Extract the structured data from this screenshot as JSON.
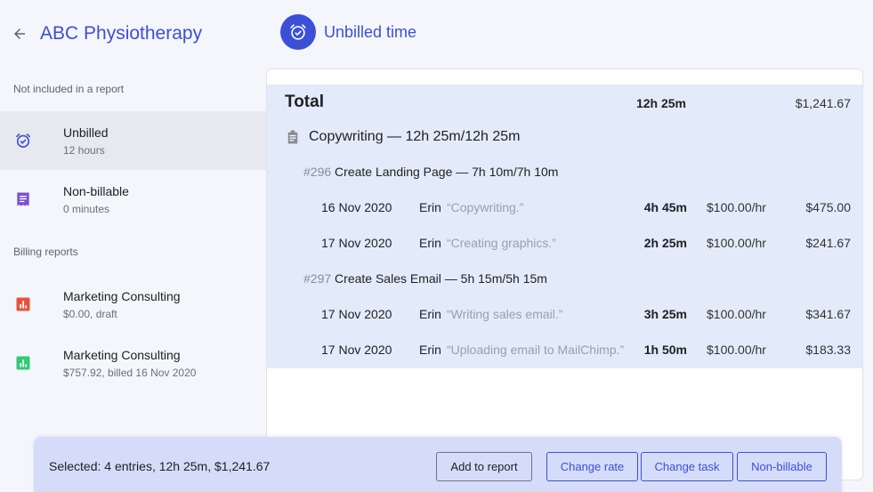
{
  "header": {
    "client_title": "ABC Physiotherapy",
    "page_title": "Unbilled time",
    "accent_color": "#3b4fd8"
  },
  "sidebar": {
    "section_not_included": "Not included in a report",
    "unbilled": {
      "name": "Unbilled",
      "sub": "12 hours",
      "icon": "alarm-clock-icon"
    },
    "nonbillable": {
      "name": "Non-billable",
      "sub": "0 minutes",
      "icon": "receipt-icon"
    },
    "section_reports": "Billing reports",
    "reports": [
      {
        "name": "Marketing Consulting",
        "sub": "$0.00, draft",
        "icon": "bar-chart-icon",
        "color": "#e5533d"
      },
      {
        "name": "Marketing Consulting",
        "sub": "$757.92, billed 16 Nov 2020",
        "icon": "bar-chart-icon",
        "color": "#2ecc71"
      }
    ]
  },
  "main": {
    "total_label": "Total",
    "total_time": "12h 25m",
    "total_amount": "$1,241.67",
    "group_label": "Copywriting — 12h 25m/12h 25m",
    "tasks": [
      {
        "num": "#296",
        "label": "Create Landing Page — 7h 10m/7h 10m",
        "entries": [
          {
            "date": "16 Nov 2020",
            "user": "Erin",
            "desc": "“Copywriting.”",
            "duration": "4h 45m",
            "rate": "$100.00/hr",
            "amount": "$475.00"
          },
          {
            "date": "17 Nov 2020",
            "user": "Erin",
            "desc": "“Creating graphics.”",
            "duration": "2h 25m",
            "rate": "$100.00/hr",
            "amount": "$241.67"
          }
        ]
      },
      {
        "num": "#297",
        "label": "Create Sales Email — 5h 15m/5h 15m",
        "entries": [
          {
            "date": "17 Nov 2020",
            "user": "Erin",
            "desc": "“Writing sales email.”",
            "duration": "3h 25m",
            "rate": "$100.00/hr",
            "amount": "$341.67"
          },
          {
            "date": "17 Nov 2020",
            "user": "Erin",
            "desc": "“Uploading email to MailChimp.”",
            "duration": "1h 50m",
            "rate": "$100.00/hr",
            "amount": "$183.33"
          }
        ]
      }
    ]
  },
  "bottom_bar": {
    "selected_text": "Selected: 4 entries, 12h 25m, $1,241.67",
    "add_to_report": "Add to report",
    "change_rate": "Change rate",
    "change_task": "Change task",
    "non_billable": "Non-billable"
  }
}
